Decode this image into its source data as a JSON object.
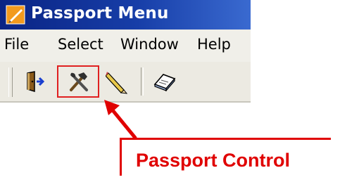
{
  "window": {
    "title": "Passport Menu",
    "app_icon": "passport-app-icon"
  },
  "menubar": {
    "items": [
      "File",
      "Select",
      "Window",
      "Help"
    ]
  },
  "toolbar": {
    "buttons": [
      {
        "icon": "exit-door-icon"
      },
      {
        "icon": "hammer-wrench-icon",
        "highlighted": true
      },
      {
        "icon": "pencil-icon"
      },
      {
        "icon": "book-icon"
      }
    ]
  },
  "annotation": {
    "label": "Passport Control",
    "color": "#e00000"
  }
}
